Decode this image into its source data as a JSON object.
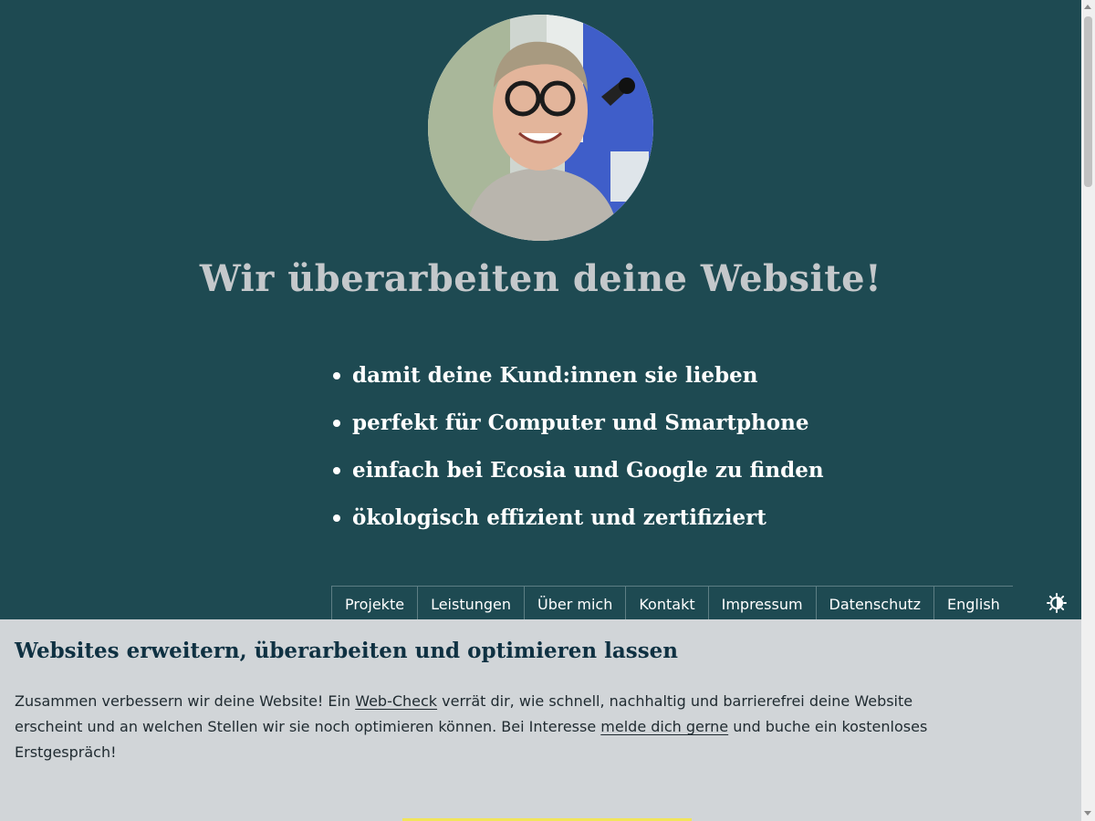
{
  "hero": {
    "title": "Wir überarbeiten deine Website!",
    "bullets": [
      "damit deine Kund:innen sie lieben",
      "perfekt für Computer und Smartphone",
      "einfach bei Ecosia und Google zu finden",
      "ökologisch effizient und zertifiziert"
    ]
  },
  "nav": {
    "items": [
      "Projekte",
      "Leistungen",
      "Über mich",
      "Kontakt",
      "Impressum",
      "Datenschutz",
      "English"
    ],
    "theme_toggle_icon": "contrast-icon"
  },
  "main": {
    "heading": "Websites erweitern, überarbeiten und optimieren lassen",
    "paragraph": {
      "text1": "Zusammen verbessern wir deine Website! Ein ",
      "link1": "Web-Check",
      "text2": " verrät dir, wie schnell, nachhaltig und barrierefrei deine Website erscheint und an welchen Stellen wir sie noch optimieren können. Bei Interesse ",
      "link2": "melde dich gerne",
      "text3": " und buche ein kostenloses Erstgespräch!"
    }
  },
  "colors": {
    "hero_background": "#1e4a52",
    "page_background": "#d1d5d8",
    "heading": "#0f3142",
    "cta_accent": "#f2e55a"
  }
}
